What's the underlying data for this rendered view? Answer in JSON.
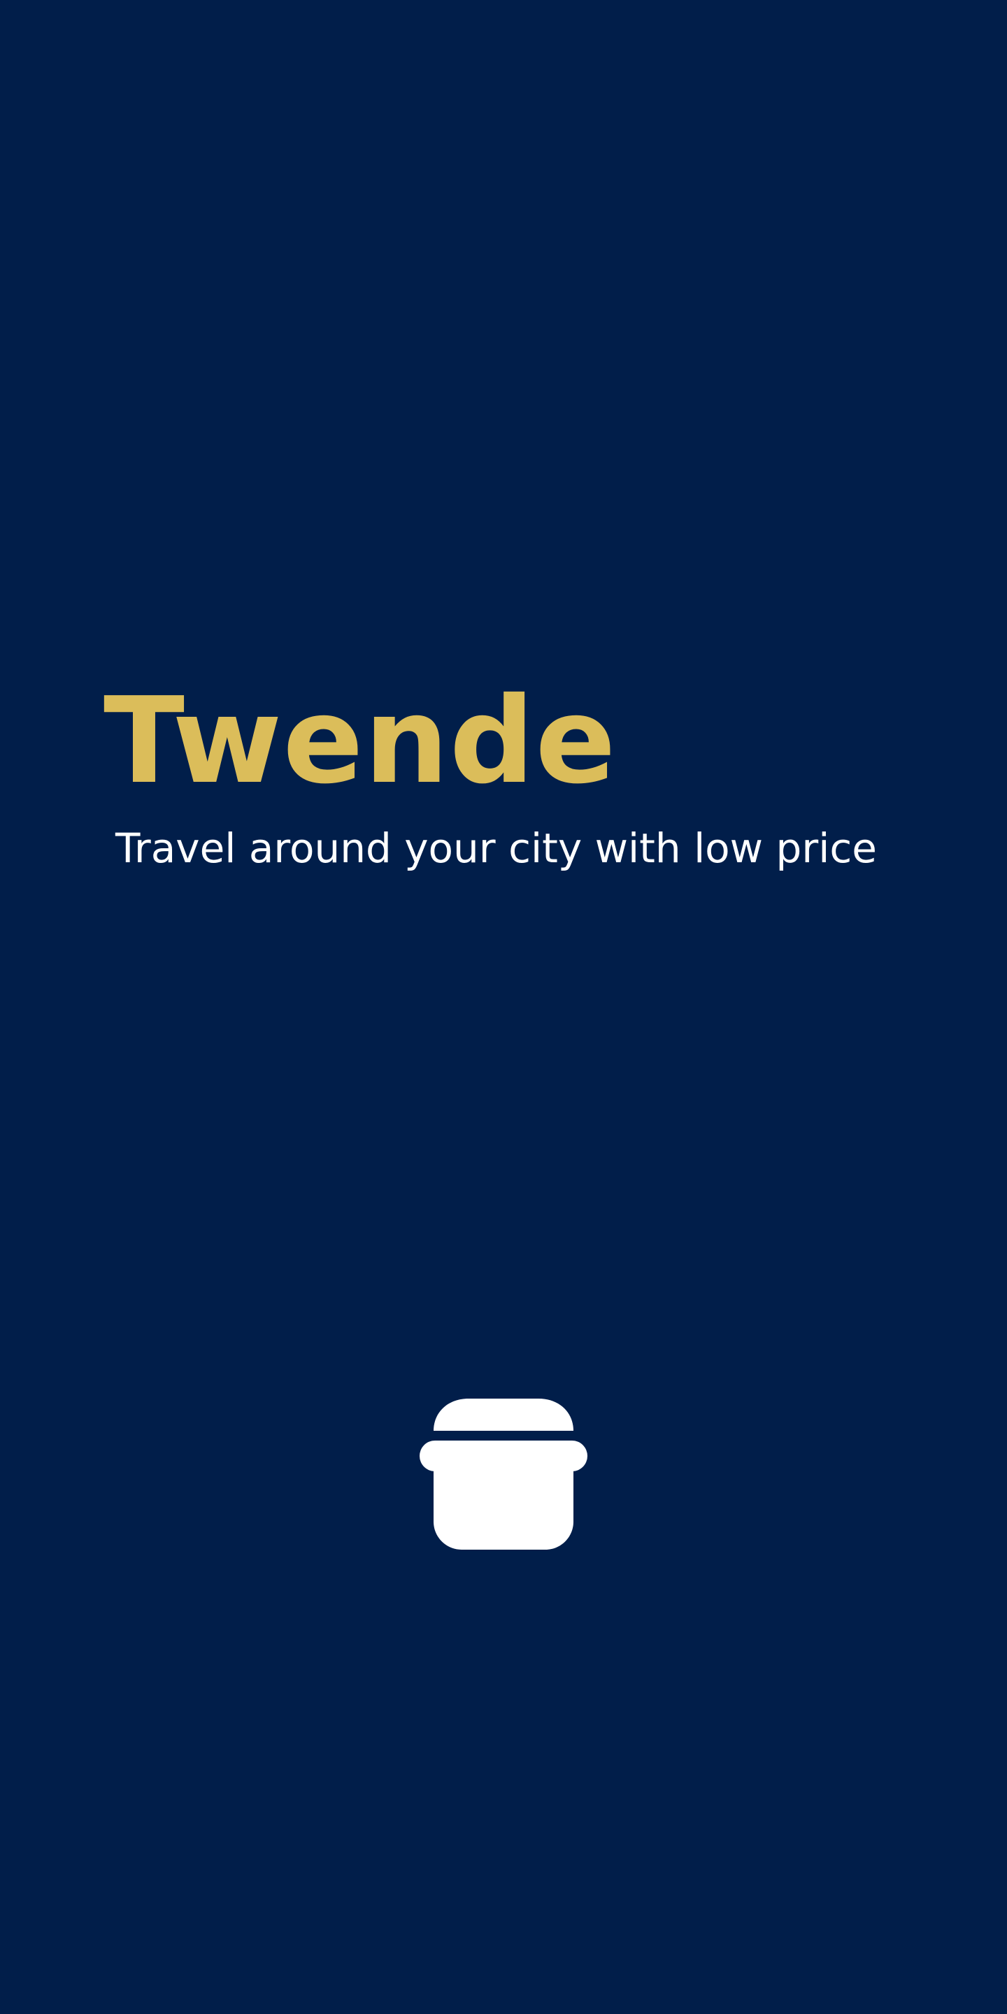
{
  "app": {
    "title": "Twende",
    "tagline": "Travel around your city with low price"
  },
  "icons": {
    "logo": "cooking-pot-icon"
  },
  "colors": {
    "background": "#011e4a",
    "title": "#dbbd5a",
    "text": "#ffffff"
  }
}
